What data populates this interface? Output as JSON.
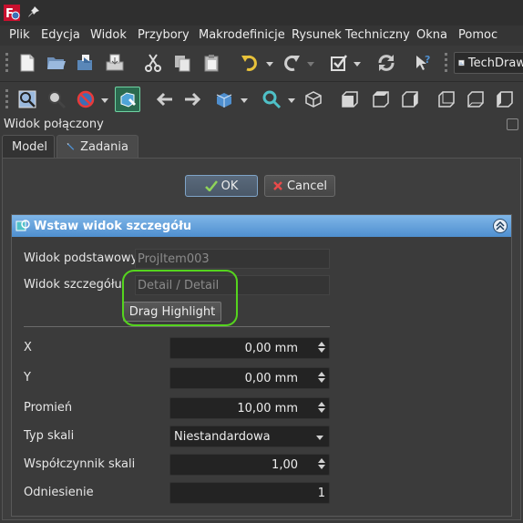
{
  "menu": {
    "items": [
      "Plik",
      "Edycja",
      "Widok",
      "Przybory",
      "Makrodefinicje",
      "Rysunek Techniczny",
      "Okna",
      "Pomoc"
    ]
  },
  "toolbar1": {
    "icons": [
      "new-file-icon",
      "open-folder-icon",
      "open-icon",
      "save-icon",
      "cut-icon",
      "copy-icon",
      "paste-icon",
      "undo-icon",
      "redo-icon",
      "refresh-checkbox-icon",
      "recompute-icon",
      "whats-this-icon",
      "techdraw-icon"
    ],
    "workbench": "TechDraw"
  },
  "toolbar2": {
    "icons": [
      "fit-all-icon",
      "fit-selection-icon",
      "draw-style-icon",
      "bounding-box-icon",
      "back-arrow-icon",
      "forward-arrow-icon",
      "sync-view-icon",
      "zoom-icon",
      "isometric-icon",
      "front-view-icon",
      "top-view-icon",
      "right-view-icon",
      "rear-view-icon",
      "bottom-view-icon",
      "left-view-icon"
    ]
  },
  "panel": {
    "title": "Widok połączony"
  },
  "tabs": {
    "model": "Model",
    "zadania": "Zadania"
  },
  "buttons": {
    "ok": "OK",
    "cancel": "Cancel"
  },
  "task": {
    "title": "Wstaw widok szczegółu",
    "base_view_label": "Widok podstawowy",
    "base_view_value": "ProjItem003",
    "detail_view_label": "Widok szczegółu",
    "detail_view_value": "Detail / Detail",
    "drag_highlight": "Drag Highlight",
    "x_label": "X",
    "x_value": "0,00 mm",
    "y_label": "Y",
    "y_value": "0,00 mm",
    "radius_label": "Promień",
    "radius_value": "10,00 mm",
    "scale_type_label": "Typ skali",
    "scale_type_value": "Niestandardowa",
    "scale_factor_label": "Współczynnik skali",
    "scale_factor_value": "1,00",
    "reference_label": "Odniesienie",
    "reference_value": "1"
  },
  "colors": {
    "accent": "#4f8fcf",
    "highlight_ring": "#55d41e"
  }
}
